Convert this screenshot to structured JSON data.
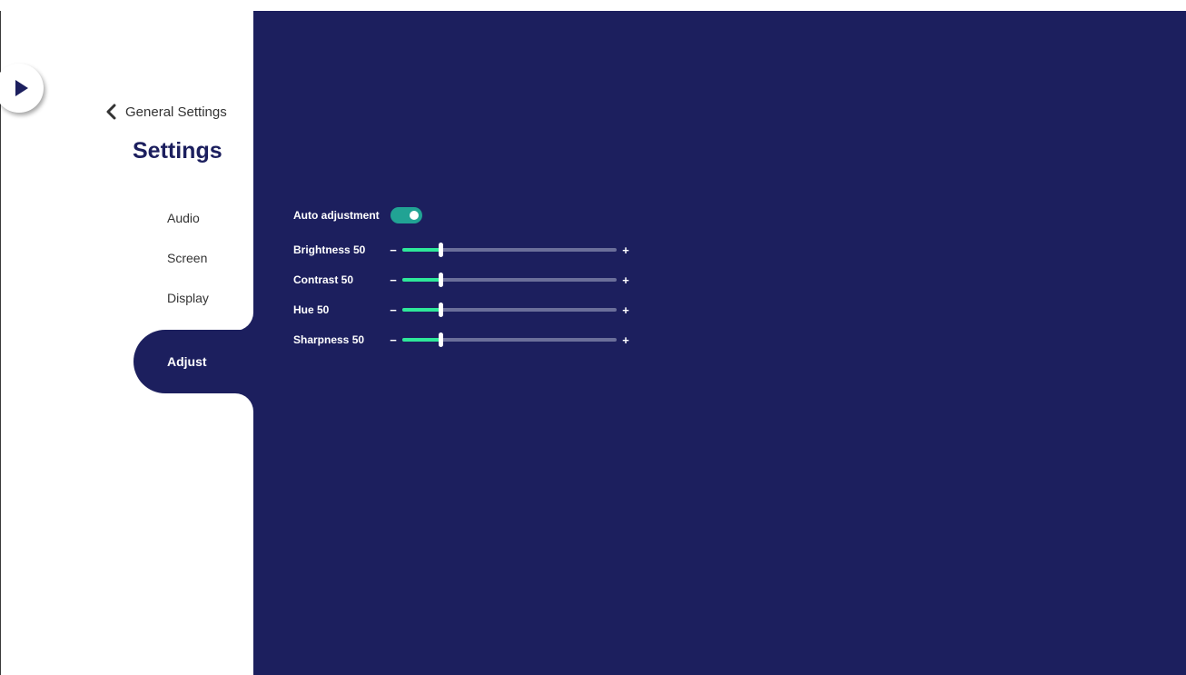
{
  "nav": {
    "back_label": "General Settings",
    "title": "Settings",
    "items": [
      {
        "label": "Audio",
        "active": false
      },
      {
        "label": "Screen",
        "active": false
      },
      {
        "label": "Display",
        "active": false
      },
      {
        "label": "Adjust",
        "active": true
      }
    ]
  },
  "adjust": {
    "auto_adjustment_label": "Auto adjustment",
    "auto_adjustment_on": true,
    "sliders": [
      {
        "label": "Brightness 50",
        "value": 50
      },
      {
        "label": "Contrast 50",
        "value": 50
      },
      {
        "label": "Hue 50",
        "value": 50
      },
      {
        "label": "Sharpness 50",
        "value": 50
      }
    ],
    "minus_symbol": "−",
    "plus_symbol": "+"
  },
  "colors": {
    "panel_bg": "#1c1f5e",
    "toggle_on": "#21a394",
    "slider_fill": "#2ee89a",
    "slider_track": "#6b6f9a"
  },
  "icons": {
    "expand": "play-icon",
    "back": "chevron-left-icon"
  }
}
